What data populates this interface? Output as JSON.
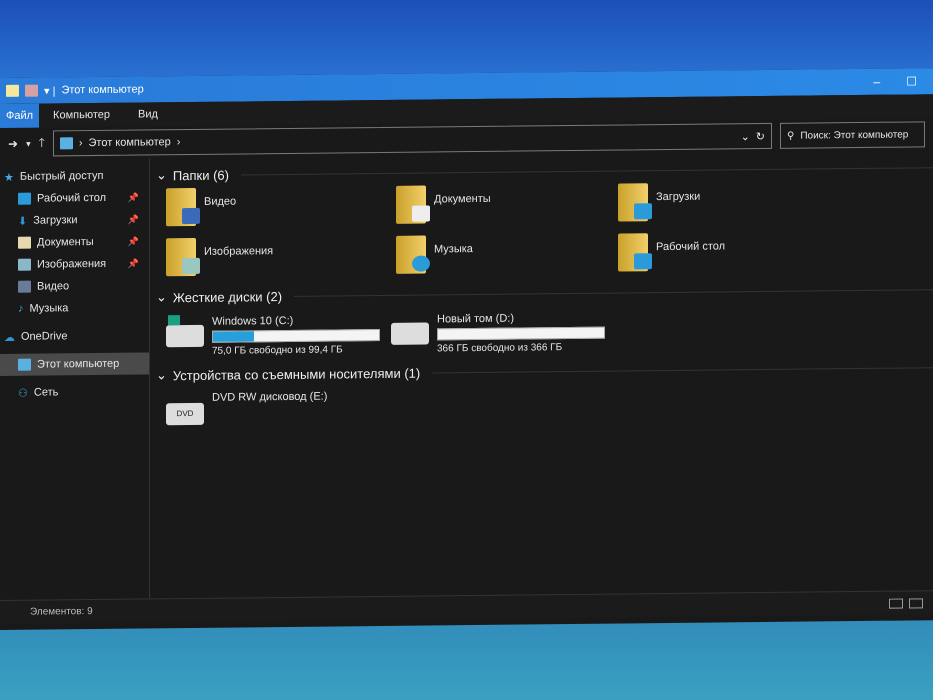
{
  "window": {
    "title": "Этот компьютер"
  },
  "ribbon": {
    "tabs": [
      "Файл",
      "Компьютер",
      "Вид"
    ]
  },
  "address": {
    "path": "Этот компьютер",
    "search_placeholder": "Поиск: Этот компьютер"
  },
  "nav": {
    "quick_access": "Быстрый доступ",
    "items": [
      "Рабочий стол",
      "Загрузки",
      "Документы",
      "Изображения",
      "Видео",
      "Музыка"
    ],
    "onedrive": "OneDrive",
    "this_pc": "Этот компьютер",
    "network": "Сеть"
  },
  "groups": {
    "folders": "Папки (6)",
    "drives": "Жесткие диски (2)",
    "removable": "Устройства со съемными носителями (1)"
  },
  "folders": [
    "Видео",
    "Документы",
    "Загрузки",
    "Изображения",
    "Музыка",
    "Рабочий стол"
  ],
  "drives": [
    {
      "name": "Windows 10 (C:)",
      "free": "75,0 ГБ свободно из 99,4 ГБ",
      "used_fraction": 0.245
    },
    {
      "name": "Новый том (D:)",
      "free": "366 ГБ свободно из 366 ГБ",
      "used_fraction": 0
    }
  ],
  "removable": [
    {
      "name": "DVD RW дисковод (E:)",
      "label": "DVD"
    }
  ],
  "status": {
    "items": "Элементов: 9"
  },
  "colors": {
    "accent": "#2a7ad8",
    "usage": "#26a0da",
    "folder": "#f2d06b"
  }
}
